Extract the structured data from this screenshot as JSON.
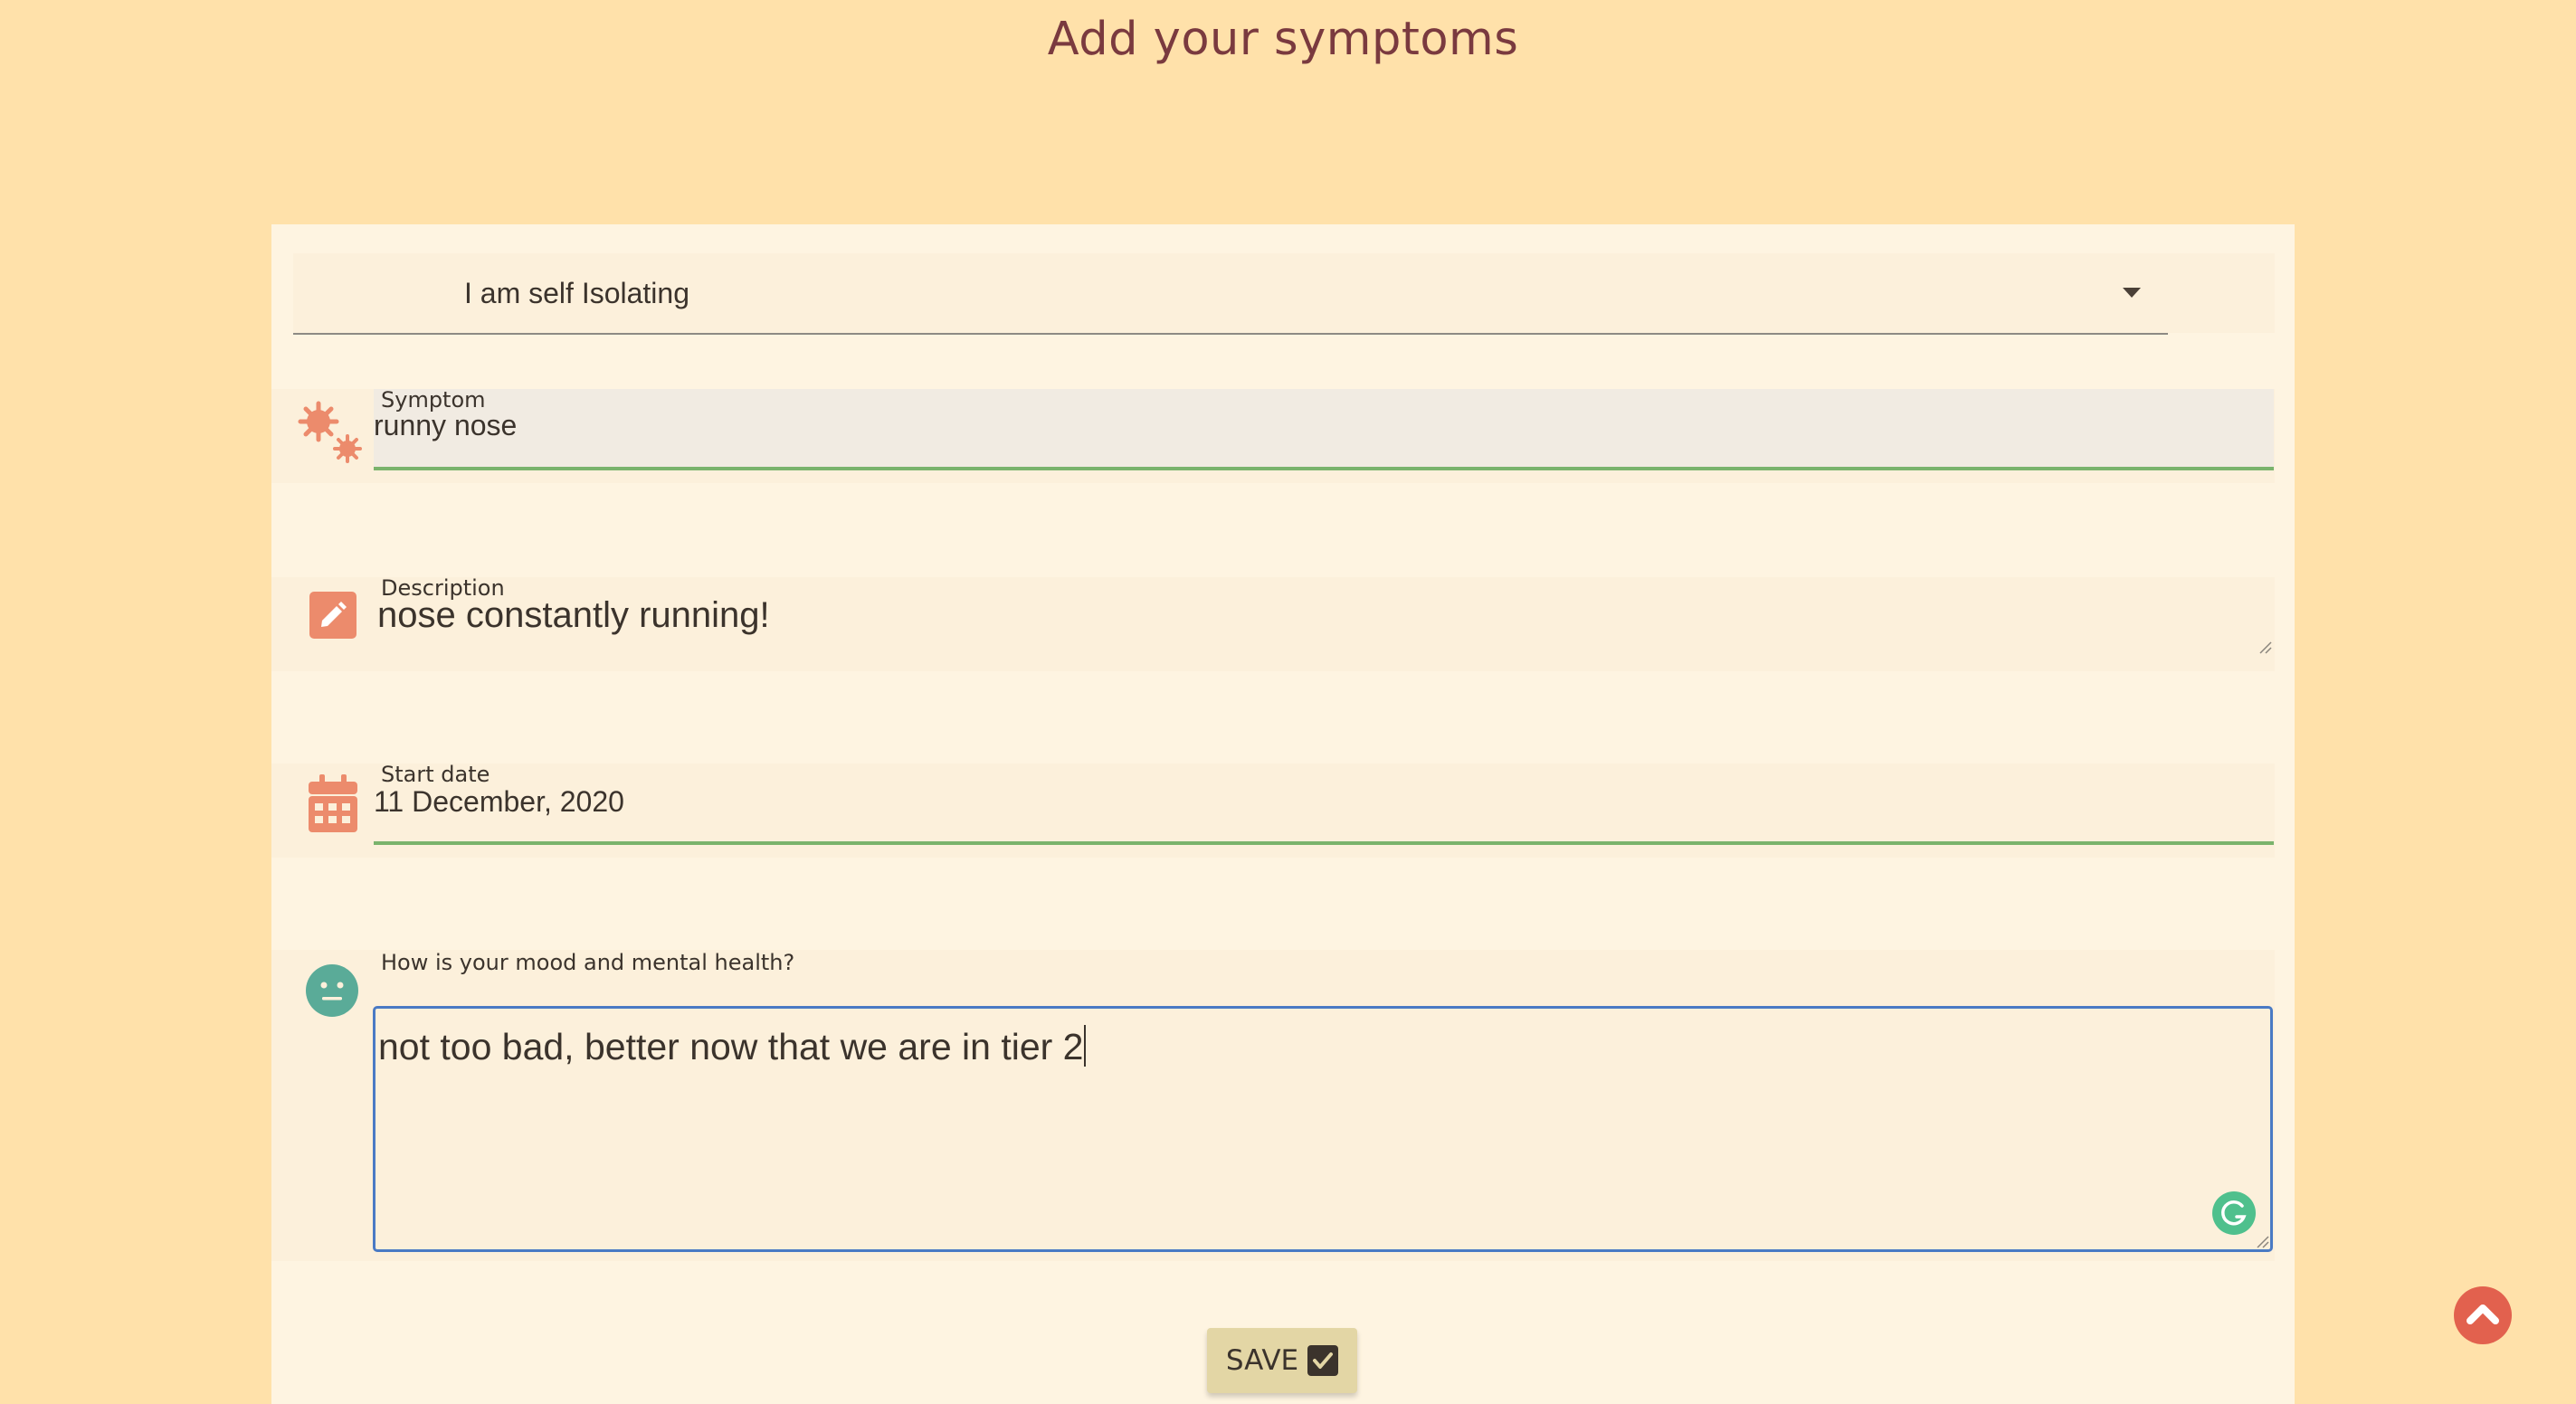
{
  "page": {
    "title": "Add your symptoms"
  },
  "isolation_select": {
    "value": "I am self Isolating",
    "icon": "chevron-down-icon"
  },
  "symptom": {
    "label": "Symptom",
    "value": "runny nose",
    "icon": "virus-icon"
  },
  "description": {
    "label": "Description",
    "value": "nose constantly running!",
    "icon": "pencil-icon"
  },
  "start_date": {
    "label": "Start date",
    "value": "11 December, 2020",
    "icon": "calendar-icon"
  },
  "mood": {
    "label": "How is your mood and mental health?",
    "value": "not too bad, better now that we are in tier 2",
    "icon": "neutral-face-icon"
  },
  "actions": {
    "save_label": "SAVE",
    "save_icon": "check-square-icon",
    "scroll_top_icon": "chevron-up-icon"
  },
  "colors": {
    "page_background": "#ffe1aa",
    "card_background": "#fef4e1",
    "title": "#7a3a3f",
    "accent_orange": "#ec8b6c",
    "accent_teal": "#5aab98",
    "valid_underline": "#7ab36c",
    "focus_border": "#4a7ac4",
    "save_button": "#e3d6a5",
    "scroll_top_button": "#e2614e"
  }
}
